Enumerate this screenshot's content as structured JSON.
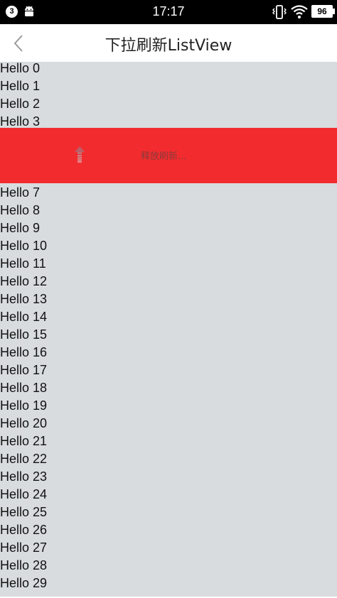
{
  "status_bar": {
    "notification_count": "3",
    "time": "17:17",
    "battery": "96",
    "icons": [
      "notification-count-icon",
      "android-icon",
      "vibrate-icon",
      "wifi-icon",
      "battery-icon"
    ]
  },
  "toolbar": {
    "title": "下拉刷新ListView",
    "back_icon": "chevron-left-icon"
  },
  "refresh_header": {
    "text": "释放刷新...",
    "icon": "arrow-up-icon",
    "color": "#f22c2e"
  },
  "colors": {
    "list_background": "#d8dcdf",
    "refresh_background": "#f22c2e",
    "status_bar": "#000000"
  },
  "list": {
    "items_top": [
      "Hello 0",
      "Hello 1",
      "Hello 2",
      "Hello 3"
    ],
    "items_bottom": [
      "Hello 7",
      "Hello 8",
      "Hello 9",
      "Hello 10",
      "Hello 11",
      "Hello 12",
      "Hello 13",
      "Hello 14",
      "Hello 15",
      "Hello 16",
      "Hello 17",
      "Hello 18",
      "Hello 19",
      "Hello 20",
      "Hello 21",
      "Hello 22",
      "Hello 23",
      "Hello 24",
      "Hello 25",
      "Hello 26",
      "Hello 27",
      "Hello 28",
      "Hello 29"
    ]
  }
}
